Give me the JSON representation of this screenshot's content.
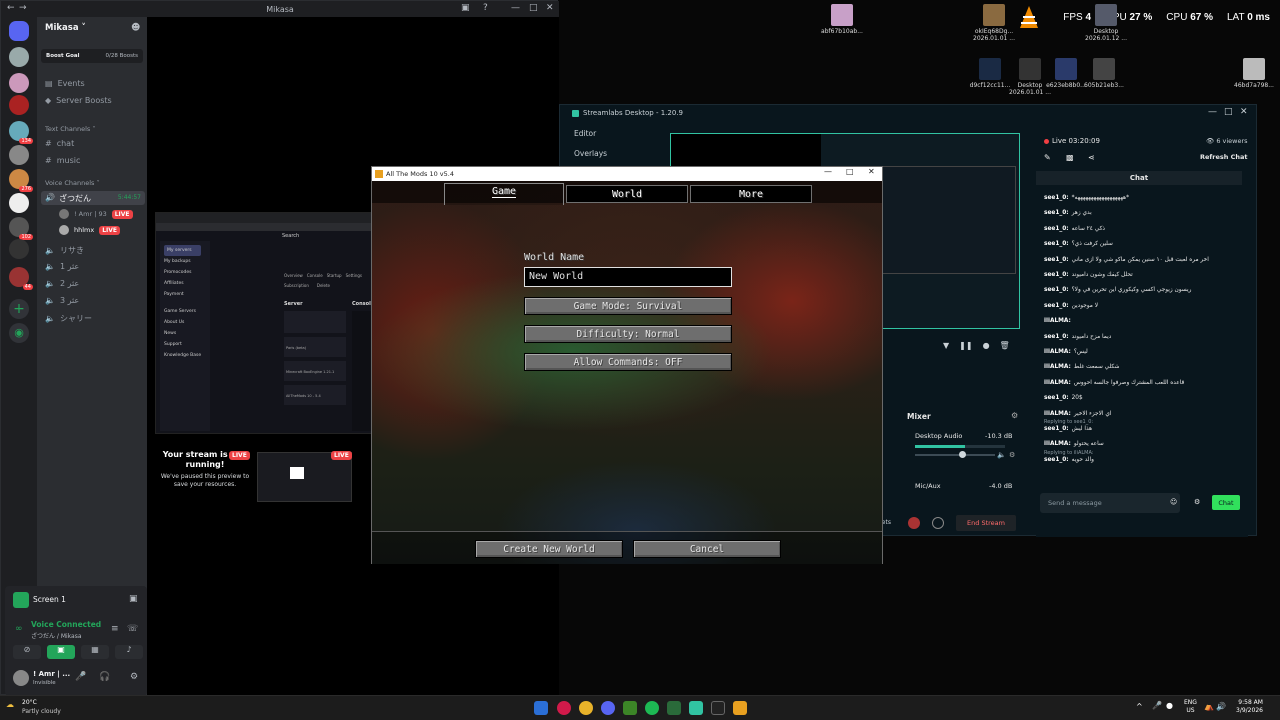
{
  "desktop": {
    "perf": {
      "fps_label": "FPS",
      "fps_value": "4",
      "gpu_label": "GPU",
      "gpu_value": "27 %",
      "cpu_label": "CPU",
      "cpu_value": "67 %",
      "lat_label": "LAT",
      "lat_value": "0 ms"
    },
    "icons": [
      {
        "label": "abf67b10ab..."
      },
      {
        "label": "okIEq68Dg... 2026.01.01 ..."
      },
      {
        "label": "Desktop 2026.01.12 ..."
      },
      {
        "label": "d9cf12cc11..."
      },
      {
        "label": "Desktop 2026.01.01 ..."
      },
      {
        "label": "e623eb8b0..."
      },
      {
        "label": "605b21eb3..."
      },
      {
        "label": "46bd7a798..."
      }
    ]
  },
  "discord": {
    "window_title": "Mikasa",
    "server_name": "Mikasa",
    "boost_goal": "Boost Goal",
    "boost_count": "0/28 Boosts",
    "events": "Events",
    "server_boosts": "Server Boosts",
    "text_channels": "Text Channels",
    "channels": [
      "chat",
      "music"
    ],
    "voice_channels": "Voice Channels",
    "voice_active": "ざつだん",
    "voice_timer": "5:44:57",
    "voice_users": [
      {
        "name": "! Amr | 93",
        "live": "LIVE"
      },
      {
        "name": "hhlmx",
        "live": "LIVE"
      }
    ],
    "other_voice": [
      "リサき",
      "عثر 1",
      "عثر 2",
      "عثر 3",
      "シャリー"
    ],
    "server_badges": [
      "134",
      "276",
      "102",
      "44"
    ],
    "stream_paused_title": "Your stream is still running!",
    "stream_paused_body": "We've paused this preview to save your resources.",
    "live_badge": "LIVE",
    "screen_label": "Screen 1",
    "voice_connected": "Voice Connected",
    "voice_location": "ざつだん / Mikasa",
    "user_name": "! Amr | ...",
    "user_status": "Invisible",
    "weather_temp": "20°C",
    "weather_desc": "Partly cloudy",
    "preview": {
      "search": "Search",
      "menu": [
        "My servers",
        "My backups",
        "Promocodes",
        "Affiliates",
        "Payment",
        "Game Servers",
        "About Us",
        "News",
        "Support",
        "Knowledge Base"
      ],
      "tabs": [
        "Overview",
        "Console",
        "Startup",
        "Settings"
      ],
      "subtabs": [
        "Subscription",
        "Delete"
      ],
      "server": "Server",
      "console": "Console",
      "version_label": "Minecraft BoxEngine 1.21.1",
      "modpack": "AllTheMods 10 - 5.4",
      "region": "Paris (beta)"
    }
  },
  "streamlabs": {
    "title": "Streamlabs Desktop - 1.20.9",
    "nav": [
      "Editor",
      "Overlays"
    ],
    "live_time": "Live 03:20:09",
    "viewers": "6 viewers",
    "refresh_chat": "Refresh Chat",
    "chat_title": "Chat",
    "messages": [
      {
        "user": "see1_0:",
        "text": "*ههههههههههههههههههه*"
      },
      {
        "user": "see1_0:",
        "text": "بدي زهر"
      },
      {
        "user": "see1_0:",
        "text": "ذكي ٢٤ ساعه"
      },
      {
        "user": "see1_0:",
        "text": "سلين كرفت ذي؟"
      },
      {
        "user": "see1_0:",
        "text": "اخر مره لعبت قبل ١٠ سنين يمكن ماكو شي ولا ازى ماني"
      },
      {
        "user": "see1_0:",
        "text": "تحلل كيفك وشون داميوند"
      },
      {
        "user": "see1_0:",
        "text": "ريسون زيوجي اكسي وكيكوري اين تحرين في ولا؟"
      },
      {
        "user": "see1_0:",
        "text": "لا موجودين"
      },
      {
        "user": "iliALMA:",
        "text": ""
      },
      {
        "user": "see1_0:",
        "text": "ديما مزح داميوند"
      },
      {
        "user": "iliALMA:",
        "text": "ليس؟"
      },
      {
        "user": "iliALMA:",
        "text": "شكلي سمعت غلط"
      },
      {
        "user": "iliALMA:",
        "text": "قاعده اللعب المشترك وصرفوا جالسه احووس"
      },
      {
        "user": "see1_0:",
        "text": "20$"
      },
      {
        "user": "iliALMA:",
        "text": "اي الاجزء الاخير"
      },
      {
        "user": "see1_0:",
        "text": "هذا ليش"
      },
      {
        "user": "iliALMA:",
        "text": "ساعه يحتولو"
      },
      {
        "user": "see1_0:",
        "text": "والد حويه"
      }
    ],
    "replies": [
      "Replying to see1_0:",
      "Replying to iliALMA:"
    ],
    "send_placeholder": "Send a message",
    "chat_button": "Chat",
    "mixer_title": "Mixer",
    "mixer": [
      {
        "name": "Desktop Audio",
        "db": "-10.3 dB",
        "level": 0.55
      },
      {
        "name": "Mic/Aux",
        "db": "-4.0 dB",
        "level": 0.6
      }
    ],
    "end_stream": "End Stream",
    "widgets": "gets"
  },
  "minecraft": {
    "window_title": "All The Mods 10 v5.4",
    "tabs": [
      "Game",
      "World",
      "More"
    ],
    "world_name_label": "World Name",
    "world_name_value": "New World",
    "game_mode": "Game Mode: Survival",
    "difficulty": "Difficulty: Normal",
    "allow_commands": "Allow Commands: OFF",
    "create_button": "Create New World",
    "cancel_button": "Cancel"
  },
  "taskbar": {
    "lang": "ENG",
    "region": "US",
    "time": "9:58 AM",
    "date": "3/9/2026"
  }
}
